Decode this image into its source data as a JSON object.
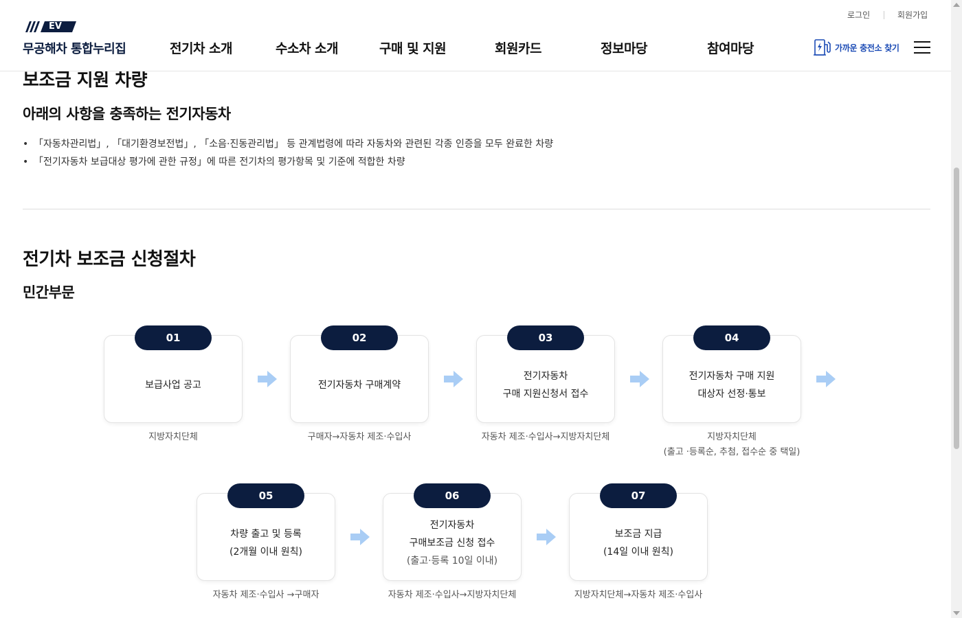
{
  "header": {
    "logo_badge": "EV",
    "logo_text": "무공해차 통합누리집",
    "util": {
      "login": "로그인",
      "signup": "회원가입"
    },
    "nav": [
      "전기차 소개",
      "수소차 소개",
      "구매 및 지원",
      "회원카드",
      "정보마당",
      "참여마당"
    ],
    "charger_label": "가까운 충전소 찾기"
  },
  "section1": {
    "title": "보조금 지원 차량",
    "subtitle": "아래의 사항을 충족하는 전기자동차",
    "bullets": [
      "「자동차관리법」, 「대기환경보전법」, 「소음·진동관리법」 등 관계법령에 따라 자동차와 관련된 각종 인증을 모두 완료한 차량",
      "「전기자동차 보급대상 평가에 관한 규정」에 따른 전기차의 평가항목 및 기준에 적합한 차량"
    ]
  },
  "section2": {
    "title": "전기차 보조금 신청절차",
    "subtitle": "민간부문",
    "steps": [
      {
        "num": "01",
        "lines": [
          "보급사업 공고"
        ],
        "actor": [
          "지방자치단체"
        ]
      },
      {
        "num": "02",
        "lines": [
          "전기자동차 구매계약"
        ],
        "actor": [
          "구매자→자동차 제조·수입사"
        ]
      },
      {
        "num": "03",
        "lines": [
          "전기자동차",
          "구매 지원신청서 접수"
        ],
        "actor": [
          "자동차 제조·수입사→지방자치단체"
        ]
      },
      {
        "num": "04",
        "lines": [
          "전기자동차 구매 지원",
          "대상자 선정·통보"
        ],
        "actor": [
          "지방자치단체",
          "(출고 ·등록순, 추첨, 접수순 중 택일)"
        ]
      },
      {
        "num": "05",
        "lines": [
          "차량 출고 및 등록",
          "(2개월 이내 원칙)"
        ],
        "actor": [
          "자동차 제조·수입사 →구매자"
        ]
      },
      {
        "num": "06",
        "lines": [
          "전기자동차",
          "구매보조금 신청 접수",
          "(출고·등록 10일 이내)"
        ],
        "actor": [
          "자동차 제조·수입사→지방자치단체"
        ]
      },
      {
        "num": "07",
        "lines": [
          "보조금 지급",
          "(14일 이내 원칙)"
        ],
        "actor": [
          "지방자치단체→자동차 제조·수입사"
        ]
      }
    ]
  },
  "colors": {
    "primary": "#0c1d3f",
    "accent": "#1b4bb5",
    "arrow": "#a9cdf5"
  }
}
